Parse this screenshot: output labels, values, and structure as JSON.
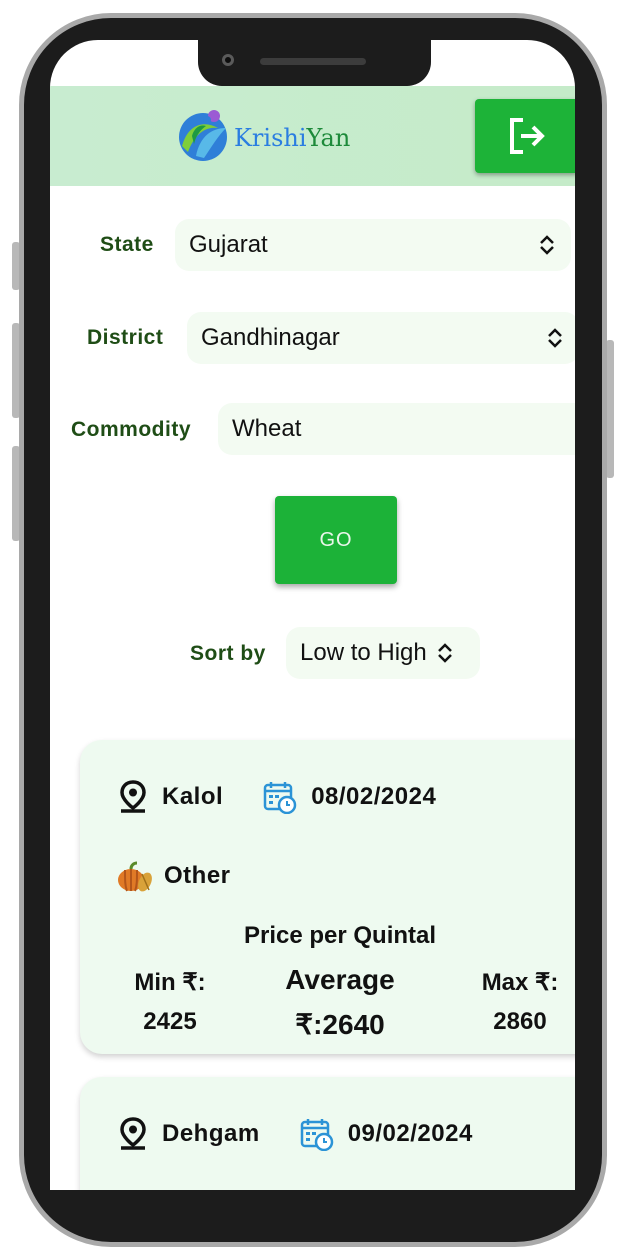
{
  "app": {
    "brand_prefix": "Krishi",
    "brand_suffix": "Yan"
  },
  "colors": {
    "primary_green": "#1db338",
    "label_green": "#1f4d16",
    "field_bg": "#f3fbf2",
    "card_bg": "#eefaf0",
    "brand_blue": "#2a7de1"
  },
  "header": {
    "logout_icon": "logout-icon"
  },
  "filters": {
    "state": {
      "label": "State",
      "value": "Gujarat"
    },
    "district": {
      "label": "District",
      "value": "Gandhinagar"
    },
    "commodity": {
      "label": "Commodity",
      "value": "Wheat"
    },
    "go_label": "GO",
    "sort": {
      "label": "Sort by",
      "value": "Low to High"
    }
  },
  "results": [
    {
      "market": "Kalol",
      "date": "08/02/2024",
      "variety": "Other",
      "price_heading": "Price per Quintal",
      "min_label": "Min ₹:",
      "min_value": "2425",
      "avg_label": "Average",
      "avg_value": "₹:2640",
      "max_label": "Max ₹:",
      "max_value": "2860"
    },
    {
      "market": "Dehgam",
      "date": "09/02/2024"
    }
  ]
}
